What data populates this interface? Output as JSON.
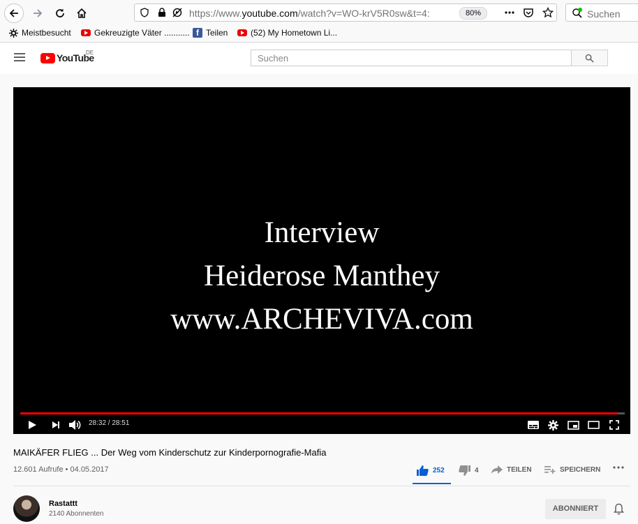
{
  "browser": {
    "url_prefix": "https://www.",
    "url_domain": "youtube.com",
    "url_rest": "/watch?v=WO-krV5R0sw&t=4:",
    "zoom": "80%",
    "search_placeholder": "Suchen",
    "bookmarks": [
      {
        "label": "Meistbesucht",
        "icon": "gear-icon"
      },
      {
        "label": "Gekreuzigte Väter ...........",
        "icon": "youtube-icon"
      },
      {
        "label": "Teilen",
        "icon": "facebook-icon"
      },
      {
        "label": "(52) My Hometown Li...",
        "icon": "youtube-icon"
      }
    ]
  },
  "youtube": {
    "logo_text": "YouTube",
    "logo_country": "DE",
    "search_placeholder": "Suchen"
  },
  "player": {
    "lines": [
      "Interview",
      "Heiderose Manthey",
      "www.ARCHEVIVA.com"
    ],
    "time": "28:32 / 28:51",
    "progress": 0.989
  },
  "video": {
    "title": "MAIKÄFER FLIEG ... Der Weg vom Kinderschutz zur Kinderpornografie-Mafia",
    "views_date": "12.601 Aufrufe • 04.05.2017",
    "likes": "252",
    "dislikes": "4",
    "share_label": "TEILEN",
    "save_label": "SPEICHERN"
  },
  "channel": {
    "name": "Rastattt",
    "subscribers": "2140 Abonnenten",
    "subscribe_label": "ABONNIERT"
  },
  "colors": {
    "accent_blue": "#065fd4",
    "youtube_red": "#ff0000"
  }
}
